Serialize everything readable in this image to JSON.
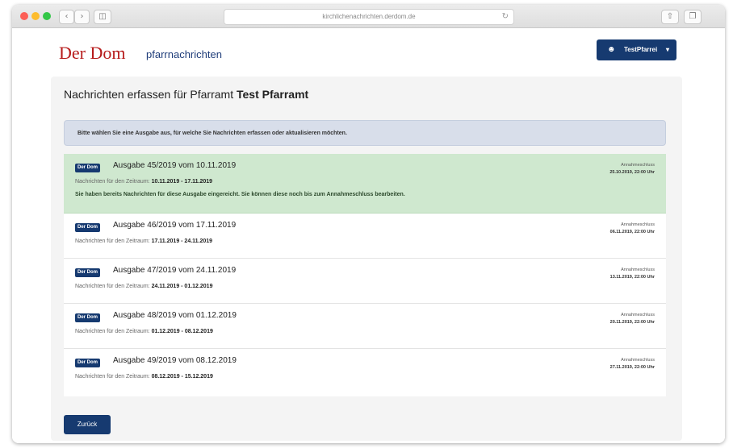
{
  "browser": {
    "url": "kirchlichenachrichten.derdom.de",
    "back_icon": "chevron-left",
    "forward_icon": "chevron-right",
    "sidebar_icon": "sidebar",
    "reload_icon": "reload",
    "share_icon": "share",
    "tabs_icon": "tabs"
  },
  "header": {
    "logo": "Der Dom",
    "logo_sub": "pfarrnachrichten",
    "user_menu_label": "TestPfarrei",
    "user_icon": "user",
    "caret_icon": "caret-down"
  },
  "main": {
    "title_prefix": "Nachrichten erfassen für Pfarramt",
    "title_parish": "Test Pfarramt",
    "info": "Bitte wählen Sie eine Ausgabe aus, für welche Sie Nachrichten erfassen oder aktualisieren möchten.",
    "issues": [
      {
        "badge": "Der Dom",
        "title": "Ausgabe 45/2019 vom 10.11.2019",
        "period_label": "Nachrichten für den Zeitraum:",
        "period": "10.11.2019 - 17.11.2019",
        "note": "Sie haben bereits Nachrichten für diese Ausgabe eingereicht. Sie können diese noch bis zum Annahmeschluss bearbeiten.",
        "closing_label": "Annahmeschluss",
        "closing_date": "25.10.2019, 22:00 Uhr"
      },
      {
        "badge": "Der Dom",
        "title": "Ausgabe 46/2019 vom 17.11.2019",
        "period_label": "Nachrichten für den Zeitraum:",
        "period": "17.11.2019 - 24.11.2019",
        "note": "",
        "closing_label": "Annahmeschluss",
        "closing_date": "06.11.2019, 22:00 Uhr"
      },
      {
        "badge": "Der Dom",
        "title": "Ausgabe 47/2019 vom 24.11.2019",
        "period_label": "Nachrichten für den Zeitraum:",
        "period": "24.11.2019 - 01.12.2019",
        "note": "",
        "closing_label": "Annahmeschluss",
        "closing_date": "13.11.2019, 22:00 Uhr"
      },
      {
        "badge": "Der Dom",
        "title": "Ausgabe 48/2019 vom 01.12.2019",
        "period_label": "Nachrichten für den Zeitraum:",
        "period": "01.12.2019 - 08.12.2019",
        "note": "",
        "closing_label": "Annahmeschluss",
        "closing_date": "20.11.2019, 22:00 Uhr"
      },
      {
        "badge": "Der Dom",
        "title": "Ausgabe 49/2019 vom 08.12.2019",
        "period_label": "Nachrichten für den Zeitraum:",
        "period": "08.12.2019 - 15.12.2019",
        "note": "",
        "closing_label": "Annahmeschluss",
        "closing_date": "27.11.2019, 22:00 Uhr"
      }
    ],
    "back_label": "Zurück"
  },
  "colors": {
    "brand_red": "#b71c1c",
    "brand_blue": "#163a70",
    "highlight_green": "#cfe8cf",
    "info_background": "#d8deea"
  }
}
